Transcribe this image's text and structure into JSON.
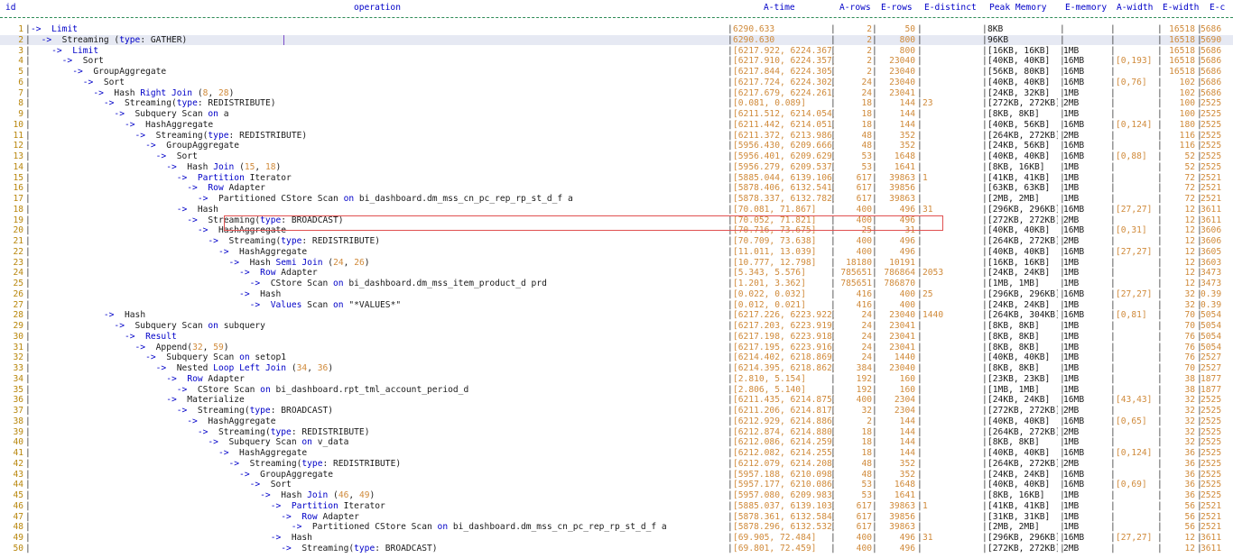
{
  "columns": [
    "id",
    "operation",
    "A-time",
    "A-rows",
    "E-rows",
    "E-distinct",
    "Peak Memory",
    "E-memory",
    "A-width",
    "E-width",
    "E-c"
  ],
  "rows": [
    {
      "id": "1",
      "op": "->  Limit",
      "atime": "6290.633",
      "arows": "2",
      "erows": "50",
      "edist": "",
      "pm": "8KB",
      "em": "",
      "aw": "",
      "ew": "16518",
      "ec": "5686"
    },
    {
      "id": "2",
      "op": "  ->  Streaming (type: GATHER)",
      "atime": "6290.630",
      "arows": "2",
      "erows": "800",
      "edist": "",
      "pm": "96KB",
      "em": "",
      "aw": "",
      "ew": "16518",
      "ec": "5690"
    },
    {
      "id": "3",
      "op": "    ->  Limit",
      "atime": "[6217.922, 6224.367]",
      "arows": "2",
      "erows": "800",
      "edist": "",
      "pm": "[16KB, 16KB]",
      "em": "1MB",
      "aw": "",
      "ew": "16518",
      "ec": "5686"
    },
    {
      "id": "4",
      "op": "      ->  Sort",
      "atime": "[6217.910, 6224.357]",
      "arows": "2",
      "erows": "23040",
      "edist": "",
      "pm": "[40KB, 40KB]",
      "em": "16MB",
      "aw": "[0,193]",
      "ew": "16518",
      "ec": "5686"
    },
    {
      "id": "5",
      "op": "        ->  GroupAggregate",
      "atime": "[6217.844, 6224.305]",
      "arows": "2",
      "erows": "23040",
      "edist": "",
      "pm": "[56KB, 80KB]",
      "em": "16MB",
      "aw": "",
      "ew": "16518",
      "ec": "5686"
    },
    {
      "id": "6",
      "op": "          ->  Sort",
      "atime": "[6217.724, 6224.302]",
      "arows": "24",
      "erows": "23040",
      "edist": "",
      "pm": "[40KB, 40KB]",
      "em": "16MB",
      "aw": "[0,76]",
      "ew": "102",
      "ec": "5686"
    },
    {
      "id": "7",
      "op": "            ->  Hash Right Join (8, 28)",
      "atime": "[6217.679, 6224.261]",
      "arows": "24",
      "erows": "23041",
      "edist": "",
      "pm": "[24KB, 32KB]",
      "em": "1MB",
      "aw": "",
      "ew": "102",
      "ec": "5686"
    },
    {
      "id": "8",
      "op": "              ->  Streaming(type: REDISTRIBUTE)",
      "atime": "[0.081, 0.089]",
      "arows": "18",
      "erows": "144",
      "edist": "23",
      "pm": "[272KB, 272KB]",
      "em": "2MB",
      "aw": "",
      "ew": "100",
      "ec": "2525"
    },
    {
      "id": "9",
      "op": "                ->  Subquery Scan on a",
      "atime": "[6211.512, 6214.054]",
      "arows": "18",
      "erows": "144",
      "edist": "",
      "pm": "[8KB, 8KB]",
      "em": "1MB",
      "aw": "",
      "ew": "100",
      "ec": "2525"
    },
    {
      "id": "10",
      "op": "                  ->  HashAggregate",
      "atime": "[6211.442, 6214.051]",
      "arows": "18",
      "erows": "144",
      "edist": "",
      "pm": "[40KB, 56KB]",
      "em": "16MB",
      "aw": "[0,124]",
      "ew": "180",
      "ec": "2525"
    },
    {
      "id": "11",
      "op": "                    ->  Streaming(type: REDISTRIBUTE)",
      "atime": "[6211.372, 6213.986]",
      "arows": "48",
      "erows": "352",
      "edist": "",
      "pm": "[264KB, 272KB]",
      "em": "2MB",
      "aw": "",
      "ew": "116",
      "ec": "2525"
    },
    {
      "id": "12",
      "op": "                      ->  GroupAggregate",
      "atime": "[5956.430, 6209.666]",
      "arows": "48",
      "erows": "352",
      "edist": "",
      "pm": "[24KB, 56KB]",
      "em": "16MB",
      "aw": "",
      "ew": "116",
      "ec": "2525"
    },
    {
      "id": "13",
      "op": "                        ->  Sort",
      "atime": "[5956.401, 6209.629]",
      "arows": "53",
      "erows": "1648",
      "edist": "",
      "pm": "[40KB, 40KB]",
      "em": "16MB",
      "aw": "[0,88]",
      "ew": "52",
      "ec": "2525"
    },
    {
      "id": "14",
      "op": "                          ->  Hash Join (15,18)",
      "atime": "[5956.279, 6209.537]",
      "arows": "53",
      "erows": "1641",
      "edist": "",
      "pm": "[8KB, 16KB]",
      "em": "1MB",
      "aw": "",
      "ew": "52",
      "ec": "2525"
    },
    {
      "id": "15",
      "op": "                            ->  Partition Iterator",
      "atime": "[5885.044, 6139.106]",
      "arows": "617",
      "erows": "39863",
      "edist": "1",
      "pm": "[41KB, 41KB]",
      "em": "1MB",
      "aw": "",
      "ew": "72",
      "ec": "2521"
    },
    {
      "id": "16",
      "op": "                              ->  Row Adapter",
      "atime": "[5878.406, 6132.541]",
      "arows": "617",
      "erows": "39856",
      "edist": "",
      "pm": "[63KB, 63KB]",
      "em": "1MB",
      "aw": "",
      "ew": "72",
      "ec": "2521"
    },
    {
      "id": "17",
      "op": "                                ->  Partitioned CStore Scan on bi_dashboard.dm_mss_cn_pc_rep_rp_st_d_f a",
      "atime": "[5878.337, 6132.782]",
      "arows": "617",
      "erows": "39863",
      "edist": "",
      "pm": "[2MB, 2MB]",
      "em": "1MB",
      "aw": "",
      "ew": "72",
      "ec": "2521"
    },
    {
      "id": "18",
      "op": "                            ->  Hash",
      "atime": "[70.081, 71.867]",
      "arows": "400",
      "erows": "496",
      "edist": "31",
      "pm": "[296KB, 296KB]",
      "em": "16MB",
      "aw": "[27,27]",
      "ew": "12",
      "ec": "3611"
    },
    {
      "id": "19",
      "op": "                              ->  Streaming(type: BROADCAST)",
      "atime": "[70.052, 71.821]",
      "arows": "400",
      "erows": "496",
      "edist": "",
      "pm": "[272KB, 272KB]",
      "em": "2MB",
      "aw": "",
      "ew": "12",
      "ec": "3611"
    },
    {
      "id": "20",
      "op": "                                ->  HashAggregate",
      "atime": "[70.716, 73.675]",
      "arows": "25",
      "erows": "31",
      "edist": "",
      "pm": "[40KB, 40KB]",
      "em": "16MB",
      "aw": "[0,31]",
      "ew": "12",
      "ec": "3606"
    },
    {
      "id": "21",
      "op": "                                  ->  Streaming(type: REDISTRIBUTE)",
      "atime": "[70.709, 73.638]",
      "arows": "400",
      "erows": "496",
      "edist": "",
      "pm": "[264KB, 272KB]",
      "em": "2MB",
      "aw": "",
      "ew": "12",
      "ec": "3606"
    },
    {
      "id": "22",
      "op": "                                    ->  HashAggregate",
      "atime": "[11.011, 13.039]",
      "arows": "400",
      "erows": "496",
      "edist": "",
      "pm": "[40KB, 40KB]",
      "em": "16MB",
      "aw": "[27,27]",
      "ew": "12",
      "ec": "3605"
    },
    {
      "id": "23",
      "op": "                                      ->  Hash Semi Join (24, 26)",
      "atime": "[10.777, 12.798]",
      "arows": "18180",
      "erows": "10191",
      "edist": "",
      "pm": "[16KB, 16KB]",
      "em": "1MB",
      "aw": "",
      "ew": "12",
      "ec": "3603"
    },
    {
      "id": "24",
      "op": "                                        ->  Row Adapter",
      "atime": "[5.343, 5.576]",
      "arows": "785651",
      "erows": "786864",
      "edist": "2053",
      "pm": "[24KB, 24KB]",
      "em": "1MB",
      "aw": "",
      "ew": "12",
      "ec": "3473"
    },
    {
      "id": "25",
      "op": "                                          ->  CStore Scan on bi_dashboard.dm_mss_item_product_d prd",
      "atime": "[1.201, 3.362]",
      "arows": "785651",
      "erows": "786870",
      "edist": "",
      "pm": "[1MB, 1MB]",
      "em": "1MB",
      "aw": "",
      "ew": "12",
      "ec": "3473"
    },
    {
      "id": "26",
      "op": "                                        ->  Hash",
      "atime": "[0.022, 0.032]",
      "arows": "416",
      "erows": "400",
      "edist": "25",
      "pm": "[296KB, 296KB]",
      "em": "16MB",
      "aw": "[27,27]",
      "ew": "32",
      "ec": "0.39"
    },
    {
      "id": "27",
      "op": "                                          ->  Values Scan on \"*VALUES*\"",
      "atime": "[0.012, 0.021]",
      "arows": "416",
      "erows": "400",
      "edist": "",
      "pm": "[24KB, 24KB]",
      "em": "1MB",
      "aw": "",
      "ew": "32",
      "ec": "0.39"
    },
    {
      "id": "28",
      "op": "              ->  Hash",
      "atime": "[6217.226, 6223.922]",
      "arows": "24",
      "erows": "23040",
      "edist": "1440",
      "pm": "[264KB, 304KB]",
      "em": "16MB",
      "aw": "[0,81]",
      "ew": "70",
      "ec": "5054"
    },
    {
      "id": "29",
      "op": "                ->  Subquery Scan on subquery",
      "atime": "[6217.203, 6223.919]",
      "arows": "24",
      "erows": "23041",
      "edist": "",
      "pm": "[8KB, 8KB]",
      "em": "1MB",
      "aw": "",
      "ew": "70",
      "ec": "5054"
    },
    {
      "id": "30",
      "op": "                  ->  Result",
      "atime": "[6217.198, 6223.918]",
      "arows": "24",
      "erows": "23041",
      "edist": "",
      "pm": "[8KB, 8KB]",
      "em": "1MB",
      "aw": "",
      "ew": "76",
      "ec": "5054"
    },
    {
      "id": "31",
      "op": "                    ->  Append(32, 59)",
      "atime": "[6217.195, 6223.916]",
      "arows": "24",
      "erows": "23041",
      "edist": "",
      "pm": "[8KB, 8KB]",
      "em": "1MB",
      "aw": "",
      "ew": "76",
      "ec": "5054"
    },
    {
      "id": "32",
      "op": "                      ->  Subquery Scan on setop1",
      "atime": "[6214.402, 6218.869]",
      "arows": "24",
      "erows": "1440",
      "edist": "",
      "pm": "[40KB, 40KB]",
      "em": "1MB",
      "aw": "",
      "ew": "76",
      "ec": "2527"
    },
    {
      "id": "33",
      "op": "                        ->  Nested Loop Left Join (34, 36)",
      "atime": "[6214.395, 6218.862]",
      "arows": "384",
      "erows": "23040",
      "edist": "",
      "pm": "[8KB, 8KB]",
      "em": "1MB",
      "aw": "",
      "ew": "70",
      "ec": "2527"
    },
    {
      "id": "34",
      "op": "                          ->  Row Adapter",
      "atime": "[2.810, 5.154]",
      "arows": "192",
      "erows": "160",
      "edist": "",
      "pm": "[23KB, 23KB]",
      "em": "1MB",
      "aw": "",
      "ew": "38",
      "ec": "1877"
    },
    {
      "id": "35",
      "op": "                            ->  CStore Scan on bi_dashboard.rpt_tml_account_period_d",
      "atime": "[2.806, 5.140]",
      "arows": "192",
      "erows": "160",
      "edist": "",
      "pm": "[1MB, 1MB]",
      "em": "1MB",
      "aw": "",
      "ew": "38",
      "ec": "1877"
    },
    {
      "id": "36",
      "op": "                          ->  Materialize",
      "atime": "[6211.435, 6214.875]",
      "arows": "400",
      "erows": "2304",
      "edist": "",
      "pm": "[24KB, 24KB]",
      "em": "16MB",
      "aw": "[43,43]",
      "ew": "32",
      "ec": "2525"
    },
    {
      "id": "37",
      "op": "                            ->  Streaming(type: BROADCAST)",
      "atime": "[6211.206, 6214.817]",
      "arows": "32",
      "erows": "2304",
      "edist": "",
      "pm": "[272KB, 272KB]",
      "em": "2MB",
      "aw": "",
      "ew": "32",
      "ec": "2525"
    },
    {
      "id": "38",
      "op": "                              ->  HashAggregate",
      "atime": "[6212.929, 6214.886]",
      "arows": "2",
      "erows": "144",
      "edist": "",
      "pm": "[40KB, 40KB]",
      "em": "16MB",
      "aw": "[0,65]",
      "ew": "32",
      "ec": "2525"
    },
    {
      "id": "39",
      "op": "                                ->  Streaming(type: REDISTRIBUTE)",
      "atime": "[6212.874, 6214.880]",
      "arows": "18",
      "erows": "144",
      "edist": "",
      "pm": "[264KB, 272KB]",
      "em": "2MB",
      "aw": "",
      "ew": "32",
      "ec": "2525"
    },
    {
      "id": "40",
      "op": "                                  ->  Subquery Scan on v_data",
      "atime": "[6212.086, 6214.259]",
      "arows": "18",
      "erows": "144",
      "edist": "",
      "pm": "[8KB, 8KB]",
      "em": "1MB",
      "aw": "",
      "ew": "32",
      "ec": "2525"
    },
    {
      "id": "41",
      "op": "                                    ->  HashAggregate",
      "atime": "[6212.082, 6214.255]",
      "arows": "18",
      "erows": "144",
      "edist": "",
      "pm": "[40KB, 40KB]",
      "em": "16MB",
      "aw": "[0,124]",
      "ew": "36",
      "ec": "2525"
    },
    {
      "id": "42",
      "op": "                                      ->  Streaming(type: REDISTRIBUTE)",
      "atime": "[6212.079, 6214.208]",
      "arows": "48",
      "erows": "352",
      "edist": "",
      "pm": "[264KB, 272KB]",
      "em": "2MB",
      "aw": "",
      "ew": "36",
      "ec": "2525"
    },
    {
      "id": "43",
      "op": "                                        ->  GroupAggregate",
      "atime": "[5957.188, 6210.098]",
      "arows": "48",
      "erows": "352",
      "edist": "",
      "pm": "[24KB, 24KB]",
      "em": "16MB",
      "aw": "",
      "ew": "36",
      "ec": "2525"
    },
    {
      "id": "44",
      "op": "                                          ->  Sort",
      "atime": "[5957.177, 6210.086]",
      "arows": "53",
      "erows": "1648",
      "edist": "",
      "pm": "[40KB, 40KB]",
      "em": "16MB",
      "aw": "[0,69]",
      "ew": "36",
      "ec": "2525"
    },
    {
      "id": "45",
      "op": "                                            ->  Hash Join (46,49)",
      "atime": "[5957.080, 6209.983]",
      "arows": "53",
      "erows": "1641",
      "edist": "",
      "pm": "[8KB, 16KB]",
      "em": "1MB",
      "aw": "",
      "ew": "36",
      "ec": "2525"
    },
    {
      "id": "46",
      "op": "                                              ->  Partition Iterator",
      "atime": "[5885.037, 6139.103]",
      "arows": "617",
      "erows": "39863",
      "edist": "1",
      "pm": "[41KB, 41KB]",
      "em": "1MB",
      "aw": "",
      "ew": "56",
      "ec": "2521"
    },
    {
      "id": "47",
      "op": "                                                ->  Row Adapter",
      "atime": "[5878.361, 6132.584]",
      "arows": "617",
      "erows": "39856",
      "edist": "",
      "pm": "[31KB, 31KB]",
      "em": "1MB",
      "aw": "",
      "ew": "56",
      "ec": "2521"
    },
    {
      "id": "48",
      "op": "                                                  ->  Partitioned CStore Scan on bi_dashboard.dm_mss_cn_pc_rep_rp_st_d_f a",
      "atime": "[5878.296, 6132.532]",
      "arows": "617",
      "erows": "39863",
      "edist": "",
      "pm": "[2MB, 2MB]",
      "em": "1MB",
      "aw": "",
      "ew": "56",
      "ec": "2521"
    },
    {
      "id": "49",
      "op": "                                              ->  Hash",
      "atime": "[69.905, 72.484]",
      "arows": "400",
      "erows": "496",
      "edist": "31",
      "pm": "[296KB, 296KB]",
      "em": "16MB",
      "aw": "[27,27]",
      "ew": "12",
      "ec": "3611"
    },
    {
      "id": "50",
      "op": "                                                ->  Streaming(type: BROADCAST)",
      "atime": "[69.801, 72.459]",
      "arows": "400",
      "erows": "496",
      "edist": "",
      "pm": "[272KB, 272KB]",
      "em": "2MB",
      "aw": "",
      "ew": "12",
      "ec": "3611"
    }
  ],
  "colors": {
    "keyword": "#0000c8",
    "number": "#d08a3a",
    "highlight": "#e05050",
    "separator": "#2e8b57"
  }
}
